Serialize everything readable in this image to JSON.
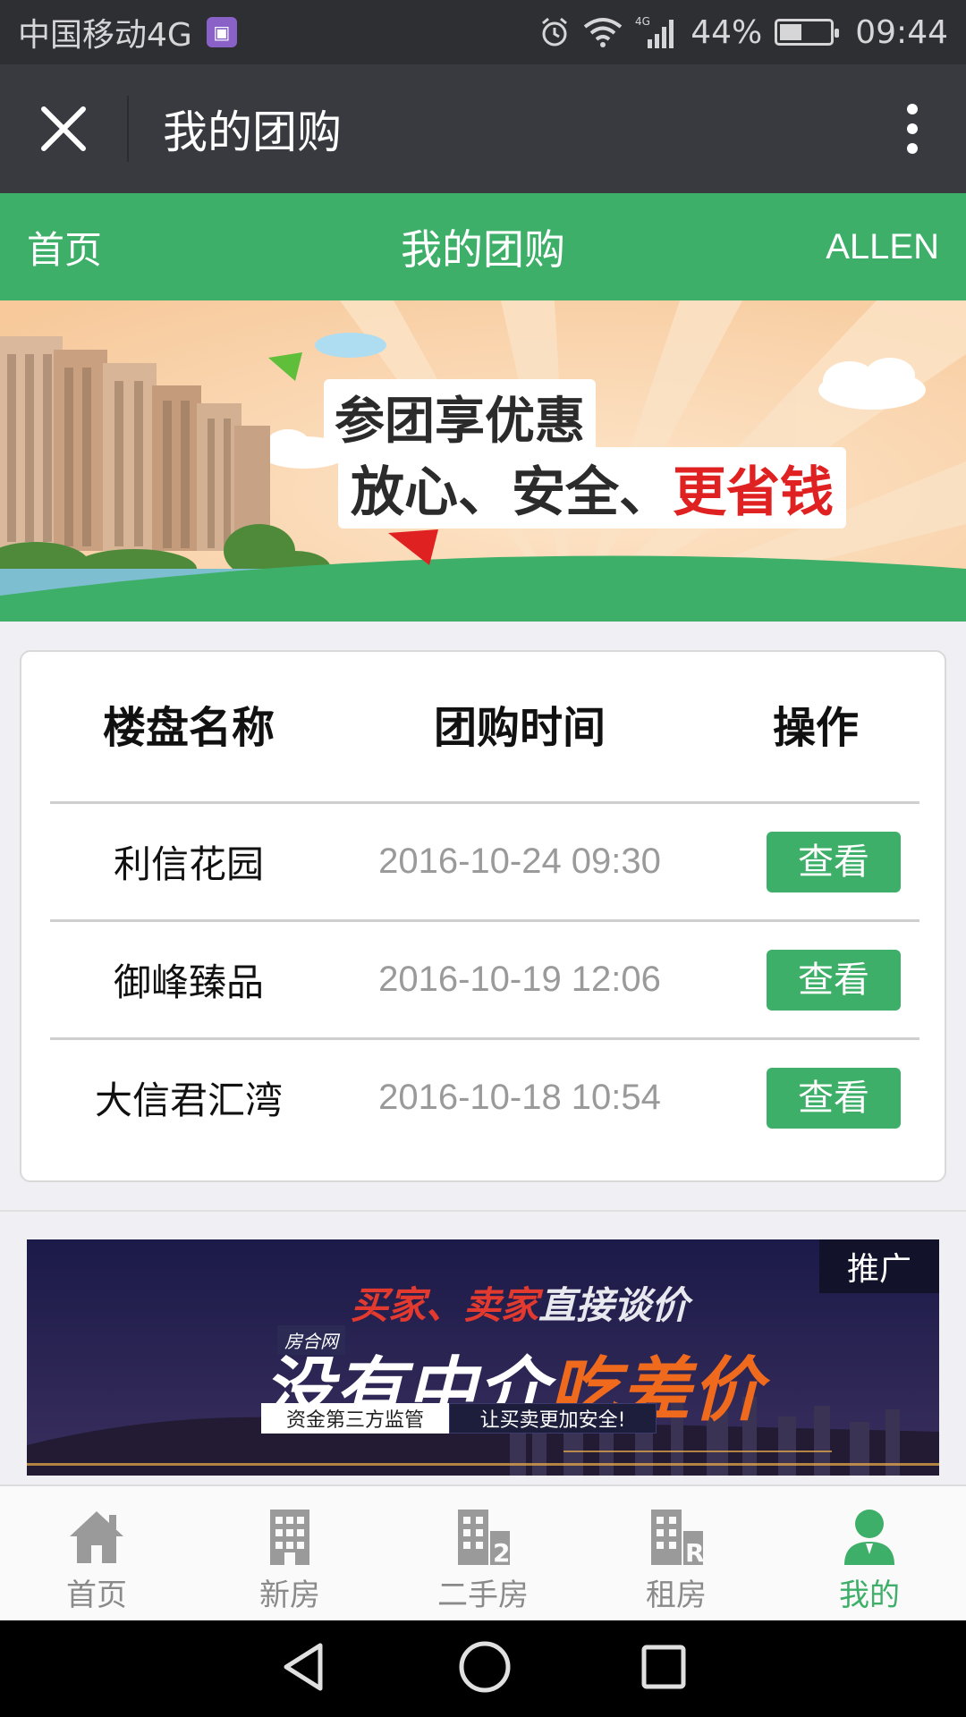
{
  "status_bar": {
    "carrier": "中国移动4G",
    "network": "4G",
    "battery": "44%",
    "battery_level": 0.44,
    "time": "09:44"
  },
  "title_bar": {
    "title": "我的团购"
  },
  "nav": {
    "home": "首页",
    "title": "我的团购",
    "user": "ALLEN"
  },
  "banner": {
    "line1": "参团享优惠",
    "line2_a": "放心、安全、",
    "line2_b": "更省钱",
    "colors": {
      "sky": "#f9d7b3",
      "ground": "#3eaf68",
      "highlight": "#e02121"
    }
  },
  "table": {
    "headers": [
      "楼盘名称",
      "团购时间",
      "操作"
    ],
    "rows": [
      {
        "name": "利信花园",
        "time": "2016-10-24 09:30",
        "action": "查看"
      },
      {
        "name": "御峰臻品",
        "time": "2016-10-19 12:06",
        "action": "查看"
      },
      {
        "name": "大信君汇湾",
        "time": "2016-10-18 10:54",
        "action": "查看"
      }
    ]
  },
  "ad": {
    "tag": "推广",
    "line1_red1": "买家",
    "line1_sep": "、",
    "line1_red2": "卖家",
    "line1_rest": "直接谈价",
    "brand": "房合网",
    "line2_white": "没有中介",
    "line2_orange": "吃差价",
    "pill1": "资金第三方监管",
    "pill2": "让买卖更加安全!"
  },
  "tabs": [
    {
      "label": "首页",
      "icon": "home-icon",
      "active": false
    },
    {
      "label": "新房",
      "icon": "building-icon",
      "active": false
    },
    {
      "label": "二手房",
      "icon": "building-2-icon",
      "active": false
    },
    {
      "label": "租房",
      "icon": "building-rent-icon",
      "active": false
    },
    {
      "label": "我的",
      "icon": "user-icon",
      "active": true
    }
  ],
  "theme": {
    "green": "#3eaf68",
    "titlebar": "#393a3f",
    "statusbar": "#2e2f33"
  }
}
